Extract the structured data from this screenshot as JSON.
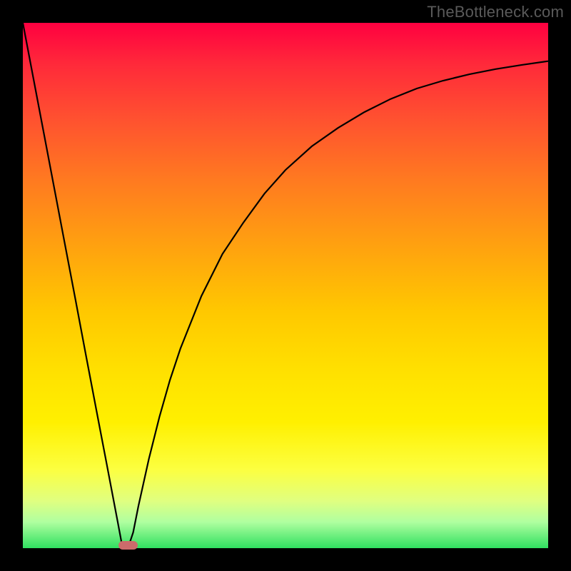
{
  "watermark": "TheBottleneck.com",
  "colors": {
    "frame": "#000000",
    "marker": "#cc6b6b",
    "curve": "#000000",
    "gradient_top": "#ff0040",
    "gradient_bottom": "#30e060"
  },
  "chart_data": {
    "type": "line",
    "title": "",
    "xlabel": "",
    "ylabel": "",
    "xlim": [
      0,
      100
    ],
    "ylim": [
      0,
      100
    ],
    "x": [
      0,
      2,
      4,
      6,
      8,
      10,
      12,
      14,
      16,
      18,
      19,
      20,
      21,
      22,
      24,
      26,
      28,
      30,
      34,
      38,
      42,
      46,
      50,
      55,
      60,
      65,
      70,
      75,
      80,
      85,
      90,
      95,
      100
    ],
    "y": [
      100,
      89.5,
      79,
      68.4,
      57.9,
      47.4,
      36.8,
      26.3,
      15.8,
      5.3,
      0,
      0,
      3,
      8,
      17,
      25,
      32,
      38,
      48,
      56,
      62,
      67.5,
      72,
      76.5,
      80,
      83,
      85.5,
      87.5,
      89,
      90.2,
      91.2,
      92,
      92.7
    ],
    "minimum_x_range": [
      19,
      21
    ],
    "annotations": []
  }
}
